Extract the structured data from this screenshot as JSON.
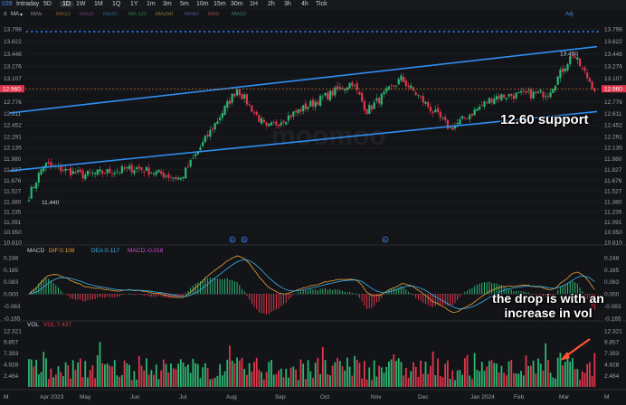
{
  "toolbar": {
    "symbol": "039",
    "timeframes": [
      "Intraday",
      "5D",
      "1D",
      "1W",
      "1M",
      "1Q",
      "1Y",
      "1m",
      "3m",
      "5m",
      "10m",
      "15m",
      "30m",
      "1H",
      "2h",
      "3h",
      "4h",
      "Tick"
    ],
    "active": "1D",
    "adj_label": "Adj"
  },
  "indicator_bar": {
    "ma_label": "MA",
    "items": [
      "MA5",
      "MA10",
      "MA20",
      "MA30",
      "MA 120",
      "MA250",
      "MA60",
      "MA5",
      "MA10"
    ],
    "colors": [
      "#e8e8e8",
      "#f0a23a",
      "#d04fd0",
      "#3ab0e8",
      "#44cc66",
      "#e0d040",
      "#8888ff",
      "#ff7777",
      "#55dddd"
    ]
  },
  "price_panel": {
    "y_ticks": [
      "13.798",
      "13.622",
      "13.448",
      "13.276",
      "13.107",
      "12.940",
      "12.776",
      "12.611",
      "12.452",
      "12.291",
      "12.135",
      "11.980",
      "11.827",
      "11.676",
      "11.527",
      "11.380",
      "11.235",
      "11.091",
      "10.950",
      "10.810"
    ],
    "current_price": "12.960",
    "high_label": "13.450",
    "low_label": "11.440",
    "watermark": "moomoo"
  },
  "macd_panel": {
    "legend_title": "MACD",
    "dif": "DIF:0.108",
    "dea": "DEA:0.117",
    "macd": "MACD:-0.018",
    "y_ticks": [
      "0.248",
      "0.165",
      "0.083",
      "0.000",
      "-0.083",
      "-0.165"
    ]
  },
  "vol_panel": {
    "legend_title": "VOL",
    "vol": "VOL:7.437",
    "y_ticks": [
      "12.321",
      "9.857",
      "7.393",
      "4.928",
      "2.464"
    ],
    "unit": "M"
  },
  "x_axis": {
    "labels": [
      "Apr 2023",
      "May",
      "Jun",
      "Jul",
      "Aug",
      "Sep",
      "Oct",
      "Nov",
      "Dec",
      "Jan 2024",
      "Feb",
      "Mar"
    ]
  },
  "annotations": {
    "support": "12.60 support",
    "volume": "the drop is with an increase in vol"
  },
  "colors": {
    "up": "#2bb673",
    "down": "#e0364b",
    "trendline": "#2f8ff0",
    "dif": "#e8a23a",
    "dea": "#3ab0e8",
    "arrow": "#ff5533"
  },
  "chart_data": {
    "type": "candlestick",
    "x_range": [
      "Apr 2023",
      "Mar 2024"
    ],
    "y_range": [
      10.81,
      13.798
    ],
    "trendlines": [
      {
        "name": "upper channel",
        "from": {
          "date": "Mar 2023",
          "price": 12.62
        },
        "to": {
          "date": "Mar 2024",
          "price": 13.55
        }
      },
      {
        "name": "lower channel",
        "from": {
          "date": "Mar 2023",
          "price": 11.81
        },
        "to": {
          "date": "Mar 2024",
          "price": 12.64
        }
      }
    ],
    "price_path": [
      {
        "date": "Apr 2023",
        "price": 11.46
      },
      {
        "date": "Apr 2023",
        "price": 11.9
      },
      {
        "date": "May",
        "price": 11.75
      },
      {
        "date": "Jun",
        "price": 11.85
      },
      {
        "date": "Jul",
        "price": 11.7
      },
      {
        "date": "Aug",
        "price": 12.96
      },
      {
        "date": "Aug",
        "price": 12.4
      },
      {
        "date": "Sep",
        "price": 12.65
      },
      {
        "date": "Oct",
        "price": 13.05
      },
      {
        "date": "Oct",
        "price": 12.65
      },
      {
        "date": "Nov",
        "price": 13.1
      },
      {
        "date": "Dec",
        "price": 12.4
      },
      {
        "date": "Jan 2024",
        "price": 12.85
      },
      {
        "date": "Feb",
        "price": 12.9
      },
      {
        "date": "Feb",
        "price": 13.45
      },
      {
        "date": "Feb",
        "price": 12.96
      }
    ],
    "macd": {
      "dif": 0.108,
      "dea": 0.117,
      "macd": -0.018,
      "y_range": [
        -0.165,
        0.248
      ]
    },
    "volume": {
      "last": 7.437,
      "unit": "M",
      "y_range": [
        0,
        12.321
      ]
    }
  }
}
